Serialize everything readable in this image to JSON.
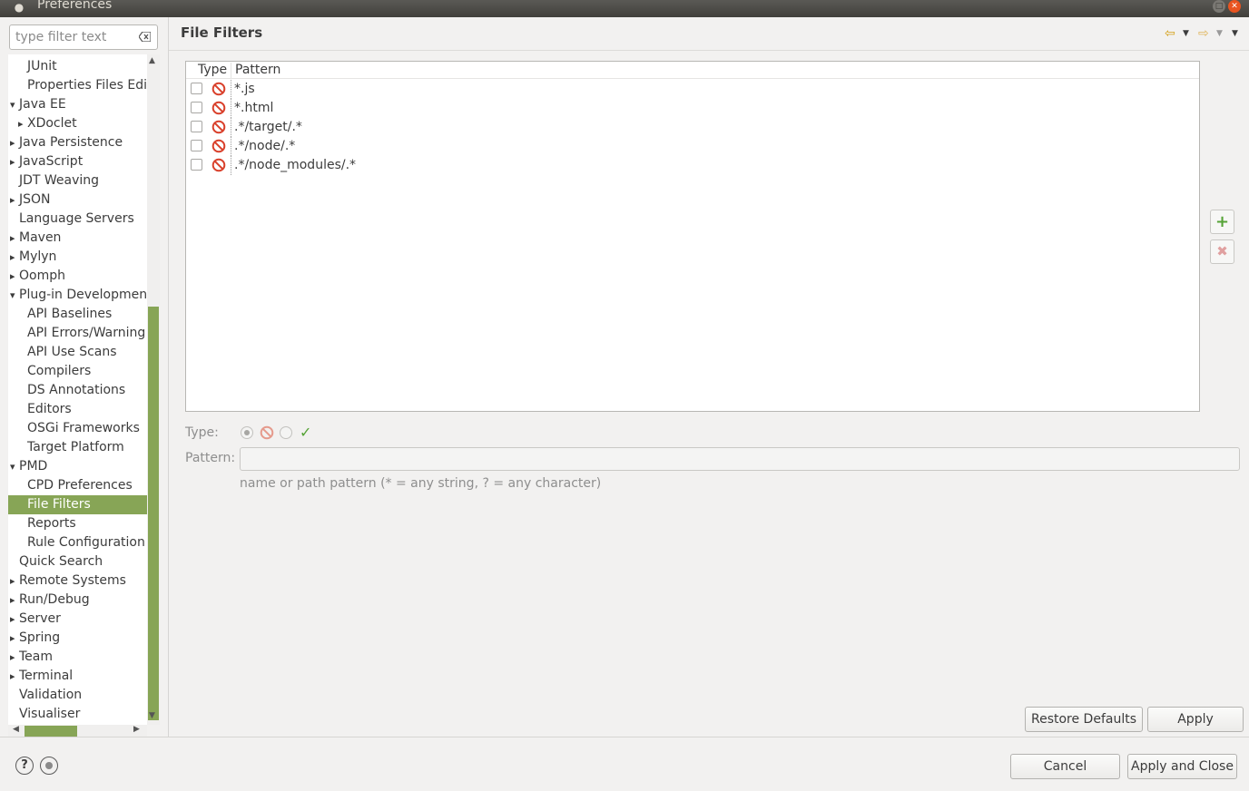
{
  "window": {
    "title": "Preferences"
  },
  "filter": {
    "placeholder": "type filter text"
  },
  "tree": {
    "items": [
      {
        "label": "JUnit",
        "depth": 1,
        "arrow": ""
      },
      {
        "label": "Properties Files Edi",
        "depth": 1,
        "arrow": ""
      },
      {
        "label": "Java EE",
        "depth": 0,
        "arrow": "expanded"
      },
      {
        "label": "XDoclet",
        "depth": 1,
        "arrow": "collapsed"
      },
      {
        "label": "Java Persistence",
        "depth": 0,
        "arrow": "collapsed"
      },
      {
        "label": "JavaScript",
        "depth": 0,
        "arrow": "collapsed"
      },
      {
        "label": "JDT Weaving",
        "depth": 0,
        "arrow": ""
      },
      {
        "label": "JSON",
        "depth": 0,
        "arrow": "collapsed"
      },
      {
        "label": "Language Servers",
        "depth": 0,
        "arrow": ""
      },
      {
        "label": "Maven",
        "depth": 0,
        "arrow": "collapsed"
      },
      {
        "label": "Mylyn",
        "depth": 0,
        "arrow": "collapsed"
      },
      {
        "label": "Oomph",
        "depth": 0,
        "arrow": "collapsed"
      },
      {
        "label": "Plug-in Development",
        "depth": 0,
        "arrow": "expanded"
      },
      {
        "label": "API Baselines",
        "depth": 1,
        "arrow": ""
      },
      {
        "label": "API Errors/Warning",
        "depth": 1,
        "arrow": ""
      },
      {
        "label": "API Use Scans",
        "depth": 1,
        "arrow": ""
      },
      {
        "label": "Compilers",
        "depth": 1,
        "arrow": ""
      },
      {
        "label": "DS Annotations",
        "depth": 1,
        "arrow": ""
      },
      {
        "label": "Editors",
        "depth": 1,
        "arrow": ""
      },
      {
        "label": "OSGi Frameworks",
        "depth": 1,
        "arrow": ""
      },
      {
        "label": "Target Platform",
        "depth": 1,
        "arrow": ""
      },
      {
        "label": "PMD",
        "depth": 0,
        "arrow": "expanded"
      },
      {
        "label": "CPD Preferences",
        "depth": 1,
        "arrow": ""
      },
      {
        "label": "File Filters",
        "depth": 1,
        "arrow": "",
        "selected": true
      },
      {
        "label": "Reports",
        "depth": 1,
        "arrow": ""
      },
      {
        "label": "Rule Configuration",
        "depth": 1,
        "arrow": ""
      },
      {
        "label": "Quick Search",
        "depth": 0,
        "arrow": ""
      },
      {
        "label": "Remote Systems",
        "depth": 0,
        "arrow": "collapsed"
      },
      {
        "label": "Run/Debug",
        "depth": 0,
        "arrow": "collapsed"
      },
      {
        "label": "Server",
        "depth": 0,
        "arrow": "collapsed"
      },
      {
        "label": "Spring",
        "depth": 0,
        "arrow": "collapsed"
      },
      {
        "label": "Team",
        "depth": 0,
        "arrow": "collapsed"
      },
      {
        "label": "Terminal",
        "depth": 0,
        "arrow": "collapsed"
      },
      {
        "label": "Validation",
        "depth": 0,
        "arrow": ""
      },
      {
        "label": "Visualiser",
        "depth": 0,
        "arrow": ""
      }
    ]
  },
  "page": {
    "title": "File Filters"
  },
  "table": {
    "columns": [
      "Type",
      "Pattern"
    ],
    "rows": [
      {
        "checked": false,
        "type": "exclude",
        "pattern": "*.js"
      },
      {
        "checked": false,
        "type": "exclude",
        "pattern": "*.html"
      },
      {
        "checked": false,
        "type": "exclude",
        "pattern": ".*/target/.*"
      },
      {
        "checked": false,
        "type": "exclude",
        "pattern": ".*/node/.*"
      },
      {
        "checked": false,
        "type": "exclude",
        "pattern": ".*/node_modules/.*"
      }
    ]
  },
  "editor": {
    "type_label": "Type:",
    "pattern_label": "Pattern:",
    "pattern_value": "",
    "hint": "name or path pattern (* = any string, ? = any character)"
  },
  "buttons": {
    "restore_defaults": "Restore Defaults",
    "apply": "Apply",
    "cancel": "Cancel",
    "apply_and_close": "Apply and Close",
    "help": "?"
  },
  "colors": {
    "selection": "#87a556",
    "exclude_icon": "#d9402b",
    "include_icon": "#55a336"
  }
}
